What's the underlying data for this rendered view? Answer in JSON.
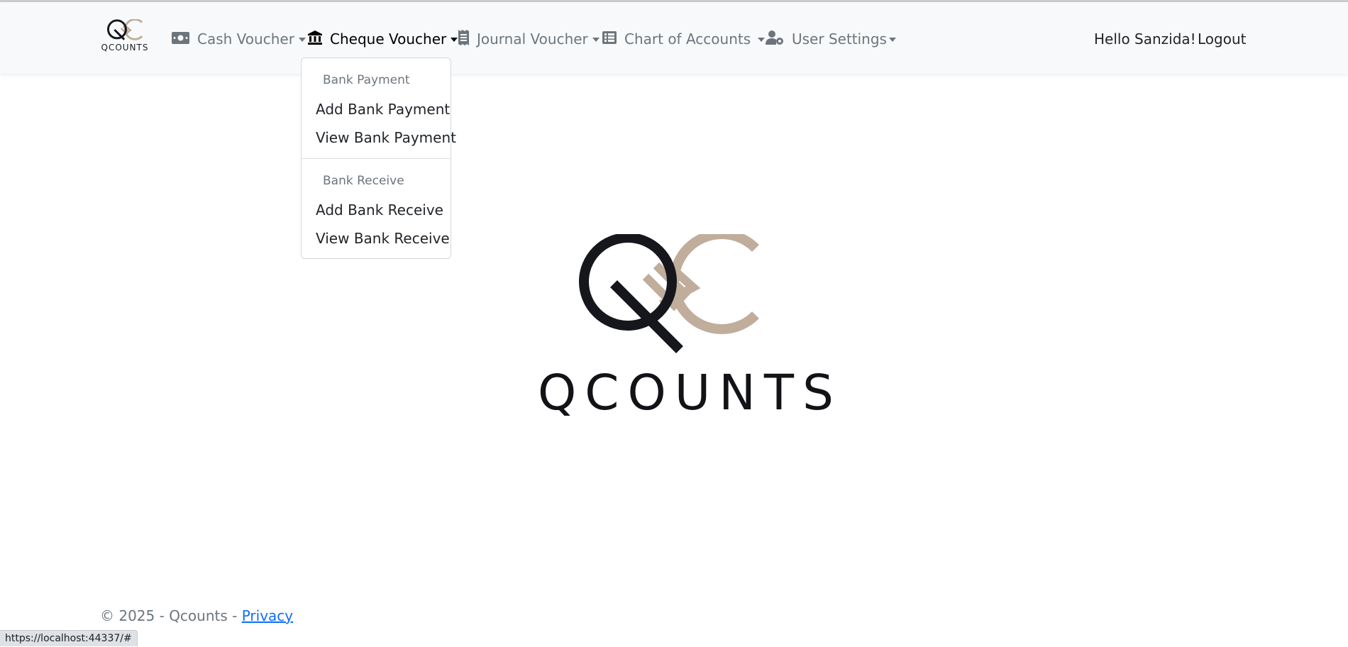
{
  "navbar": {
    "brand": {
      "text": "QCOUNTS"
    },
    "items": [
      {
        "label": "Cash Voucher",
        "icon": "money-bill-icon"
      },
      {
        "label": "Cheque Voucher",
        "icon": "bank-icon",
        "active": true
      },
      {
        "label": "Journal Voucher",
        "icon": "receipt-icon"
      },
      {
        "label": "Chart of Accounts",
        "icon": "list-table-icon"
      },
      {
        "label": "User Settings",
        "icon": "user-gear-icon"
      }
    ],
    "greeting": "Hello Sanzida!",
    "logout": "Logout"
  },
  "dropdown": {
    "sections": [
      {
        "header": "Bank Payment",
        "items": [
          "Add Bank Payment",
          "View Bank Payment"
        ]
      },
      {
        "header": "Bank Receive",
        "items": [
          "Add Bank Receive",
          "View Bank Receive"
        ]
      }
    ]
  },
  "hero": {
    "wordmark": "QCOUNTS"
  },
  "footer": {
    "copyright": "© 2025 - Qcounts - ",
    "privacy": "Privacy"
  },
  "status_bar": {
    "url": "https://localhost:44337/#"
  },
  "colors": {
    "navbar_bg": "#f8f9fa",
    "logo_dark": "#15171c",
    "logo_beige": "#c0ad9b",
    "link": "#0d6efd"
  }
}
